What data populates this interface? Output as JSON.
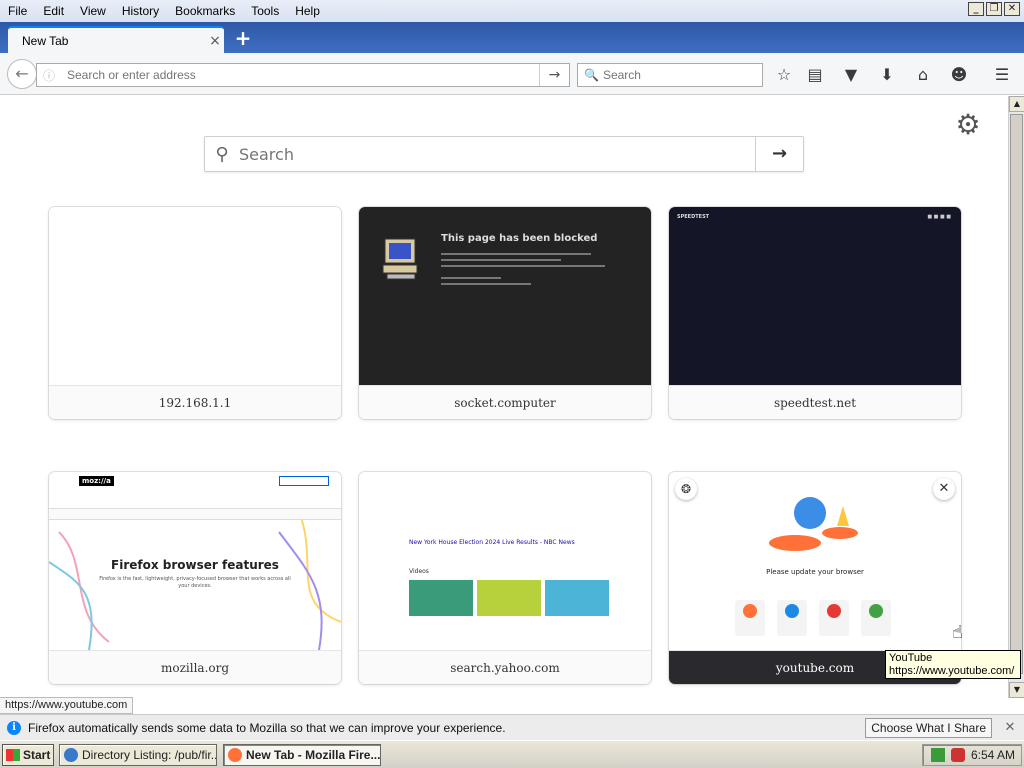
{
  "menu": [
    "File",
    "Edit",
    "View",
    "History",
    "Bookmarks",
    "Tools",
    "Help"
  ],
  "window_controls": [
    "_",
    "❐",
    "✕"
  ],
  "tab": {
    "title": "New Tab",
    "close": "×"
  },
  "newtab": "+",
  "nav": {
    "url_placeholder": "Search or enter address",
    "search_placeholder": "Search"
  },
  "newtab_page": {
    "search_placeholder": "Search",
    "tiles": [
      {
        "label": "192.168.1.1"
      },
      {
        "label": "socket.computer",
        "thumb_heading": "This page has been blocked"
      },
      {
        "label": "speedtest.net",
        "thumb_brand": "SPEEDTEST"
      },
      {
        "label": "mozilla.org",
        "thumb_heading": "Firefox browser features",
        "thumb_logo": "moz://a",
        "thumb_sub": "Firefox is the fast, lightweight, privacy-focused browser that works across all your devices."
      },
      {
        "label": "search.yahoo.com",
        "thumb_headline": "New York House Election 2024 Live Results - NBC News",
        "thumb_videos": "Videos"
      },
      {
        "label": "youtube.com",
        "thumb_heading": "Please update your browser"
      }
    ]
  },
  "tooltip": {
    "title": "YouTube",
    "url": "https://www.youtube.com/"
  },
  "status_url": "https://www.youtube.com",
  "notification": {
    "message": "Firefox automatically sends some data to Mozilla so that we can improve your experience.",
    "button": "Choose What I Share"
  },
  "taskbar": {
    "start": "Start",
    "items": [
      "Directory Listing: /pub/fir...",
      "New Tab - Mozilla Fire..."
    ],
    "clock": "6:54 AM"
  }
}
